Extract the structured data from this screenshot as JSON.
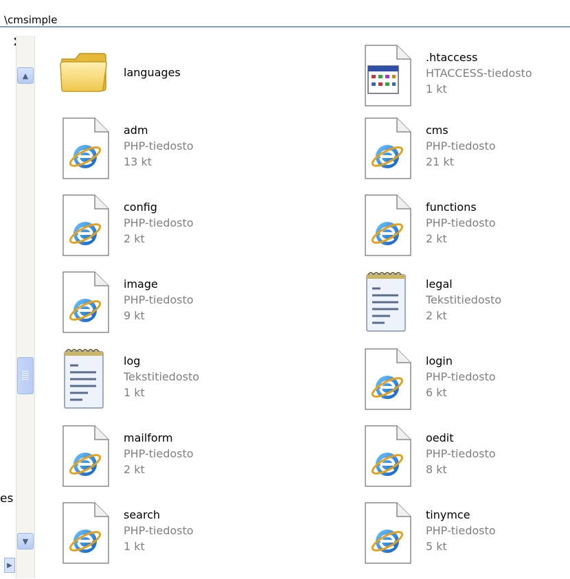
{
  "address": {
    "path": "\\cmsimple"
  },
  "left_pane": {
    "close_label": "×",
    "fragment_text": "es"
  },
  "scrollbar": {
    "up_glyph": "▲",
    "down_glyph": "▼",
    "nav_glyph": "▶"
  },
  "files": [
    {
      "name": "languages",
      "type": "",
      "size": "",
      "icon": "folder-icon"
    },
    {
      "name": ".htaccess",
      "type": "HTACCESS-tiedosto",
      "size": "1 kt",
      "icon": "htaccess-file-icon"
    },
    {
      "name": "adm",
      "type": "PHP-tiedosto",
      "size": "13 kt",
      "icon": "php-file-icon"
    },
    {
      "name": "cms",
      "type": "PHP-tiedosto",
      "size": "21 kt",
      "icon": "php-file-icon"
    },
    {
      "name": "config",
      "type": "PHP-tiedosto",
      "size": "2 kt",
      "icon": "php-file-icon"
    },
    {
      "name": "functions",
      "type": "PHP-tiedosto",
      "size": "2 kt",
      "icon": "php-file-icon"
    },
    {
      "name": "image",
      "type": "PHP-tiedosto",
      "size": "9 kt",
      "icon": "php-file-icon"
    },
    {
      "name": "legal",
      "type": "Tekstitiedosto",
      "size": "2 kt",
      "icon": "text-file-icon"
    },
    {
      "name": "log",
      "type": "Tekstitiedosto",
      "size": "1 kt",
      "icon": "text-file-icon"
    },
    {
      "name": "login",
      "type": "PHP-tiedosto",
      "size": "6 kt",
      "icon": "php-file-icon"
    },
    {
      "name": "mailform",
      "type": "PHP-tiedosto",
      "size": "2 kt",
      "icon": "php-file-icon"
    },
    {
      "name": "oedit",
      "type": "PHP-tiedosto",
      "size": "8 kt",
      "icon": "php-file-icon"
    },
    {
      "name": "search",
      "type": "PHP-tiedosto",
      "size": "1 kt",
      "icon": "php-file-icon"
    },
    {
      "name": "tinymce",
      "type": "PHP-tiedosto",
      "size": "5 kt",
      "icon": "php-file-icon"
    }
  ]
}
